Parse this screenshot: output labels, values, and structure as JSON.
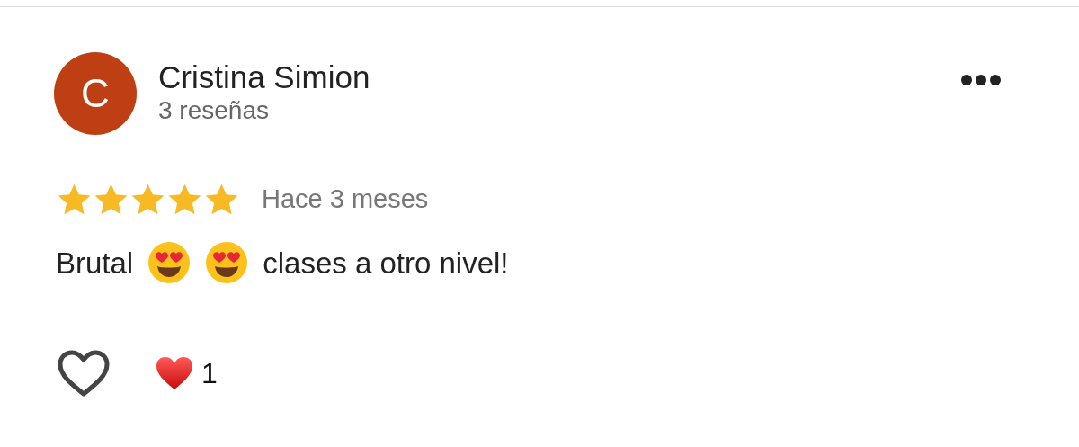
{
  "review": {
    "avatar": {
      "letter": "C",
      "color": "#bf3f14"
    },
    "author": "Cristina Simion",
    "subtitle": "3 reseñas",
    "stars": 5,
    "time": "Hace 3 meses",
    "body": [
      {
        "kind": "text",
        "text": "Brutal"
      },
      {
        "kind": "emoji"
      },
      {
        "kind": "emoji"
      },
      {
        "kind": "text",
        "text": "clases a otro nivel!"
      }
    ],
    "liked": false,
    "reaction_count": "1"
  }
}
